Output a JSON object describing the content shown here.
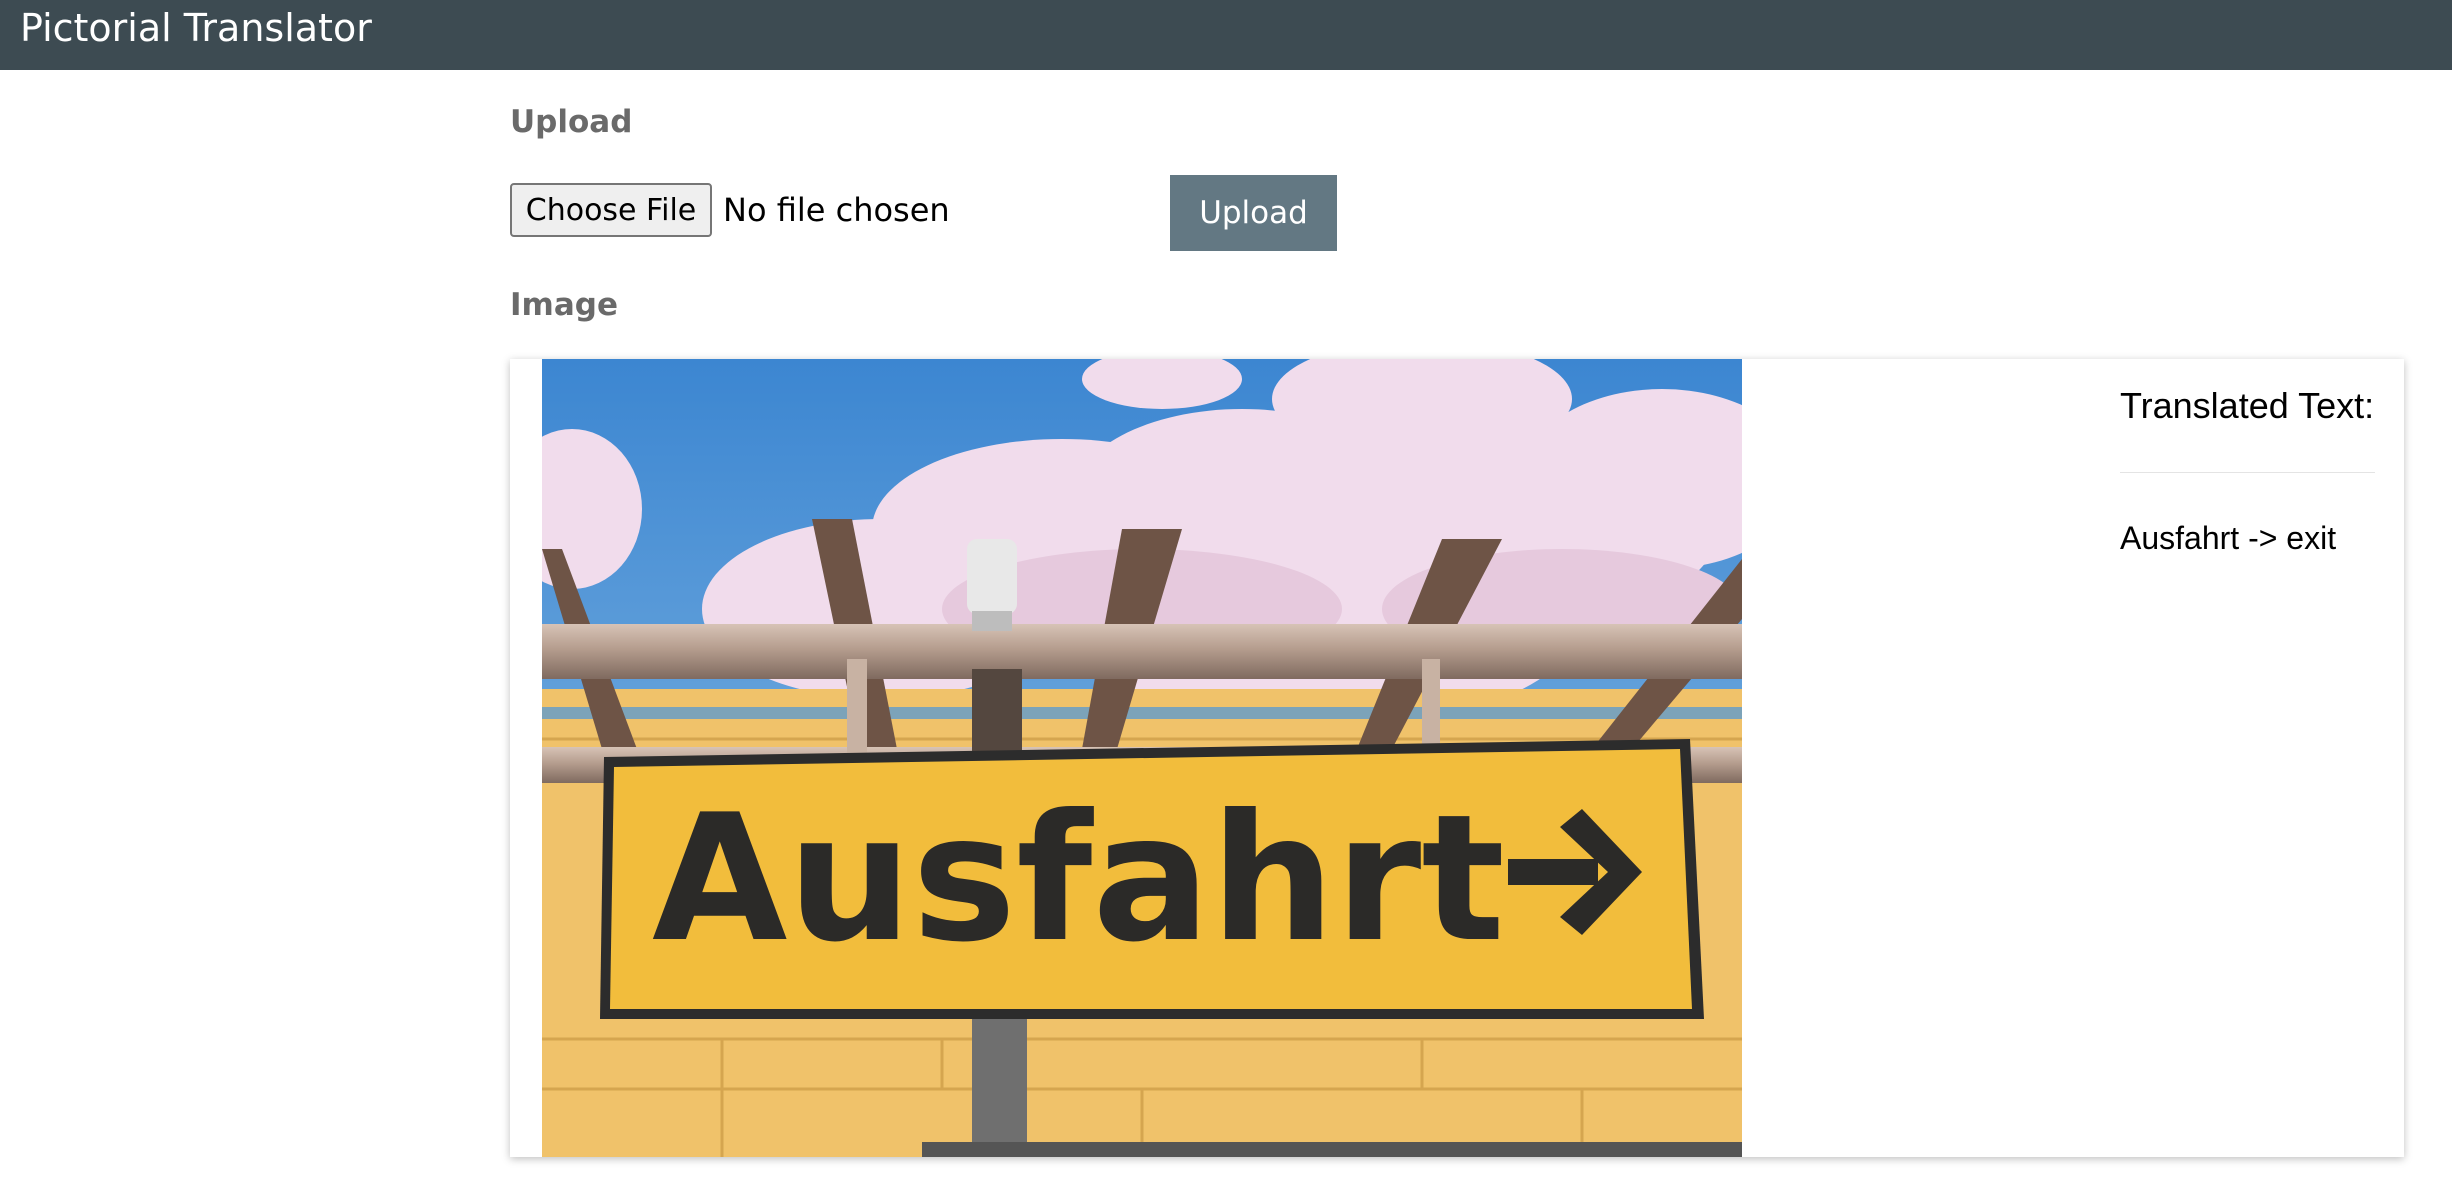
{
  "app": {
    "title": "Pictorial Translator"
  },
  "upload_section": {
    "label": "Upload",
    "choose_file_label": "Choose File",
    "file_status": "No file chosen",
    "upload_button_label": "Upload"
  },
  "image_section": {
    "label": "Image",
    "photo_sign_text": "Ausfahrt",
    "translated_heading": "Translated Text:",
    "translation": "Ausfahrt -> exit"
  },
  "colors": {
    "topbar": "#3d4b52",
    "upload_button": "#637883",
    "sign_yellow": "#f2bd3c",
    "sky_blue": "#4a8fd3"
  },
  "icons": {
    "photo_arrow": "right-arrow-icon"
  }
}
